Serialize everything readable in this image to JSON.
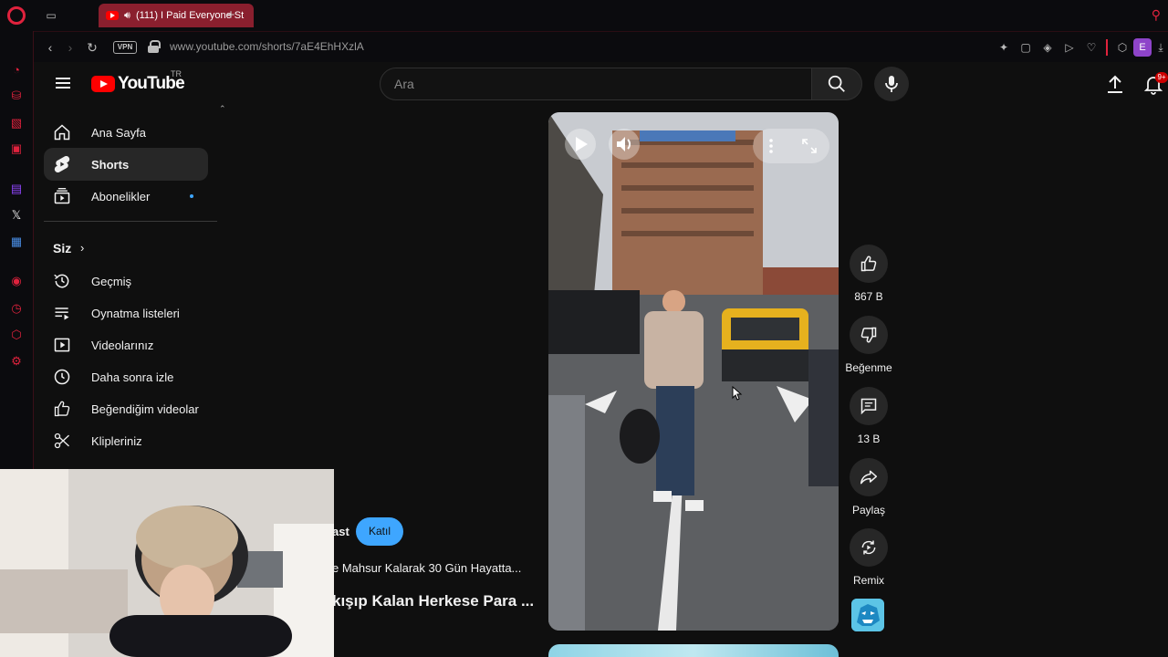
{
  "browser": {
    "tab_title": "(111) I Paid Everyone St",
    "url": "www.youtube.com/shorts/7aE4EhHXzlA",
    "vpn_label": "VPN",
    "profile_initial": "E"
  },
  "header": {
    "logo_text": "YouTube",
    "country_code": "TR",
    "search_placeholder": "Ara",
    "notification_count": "9+"
  },
  "sidebar": {
    "main_items": [
      {
        "label": "Ana Sayfa",
        "icon": "home-icon"
      },
      {
        "label": "Shorts",
        "icon": "shorts-icon",
        "active": true
      },
      {
        "label": "Abonelikler",
        "icon": "subscriptions-icon"
      }
    ],
    "you_section_label": "Siz",
    "you_items": [
      {
        "label": "Geçmiş",
        "icon": "history-icon"
      },
      {
        "label": "Oynatma listeleri",
        "icon": "playlists-icon"
      },
      {
        "label": "Videolarınız",
        "icon": "your-videos-icon"
      },
      {
        "label": "Daha sonra izle",
        "icon": "watch-later-icon"
      },
      {
        "label": "Beğendiğim videolar",
        "icon": "liked-videos-icon"
      },
      {
        "label": "Klipleriniz",
        "icon": "clips-icon"
      }
    ]
  },
  "short": {
    "channel_name_fragment": "ast",
    "join_label": "Katıl",
    "referenced_video": "e Mahsur Kalarak 30 Gün Hayatta...",
    "title_fragment": "kışıp Kalan Herkese Para ..."
  },
  "actions": {
    "like_count": "867 B",
    "dislike_label": "Beğenme",
    "comment_count": "13 B",
    "share_label": "Paylaş",
    "remix_label": "Remix"
  },
  "colors": {
    "accent_red": "#e0223d",
    "youtube_red": "#ff0000",
    "join_blue": "#3ea6ff",
    "background": "#0f0f0f"
  }
}
